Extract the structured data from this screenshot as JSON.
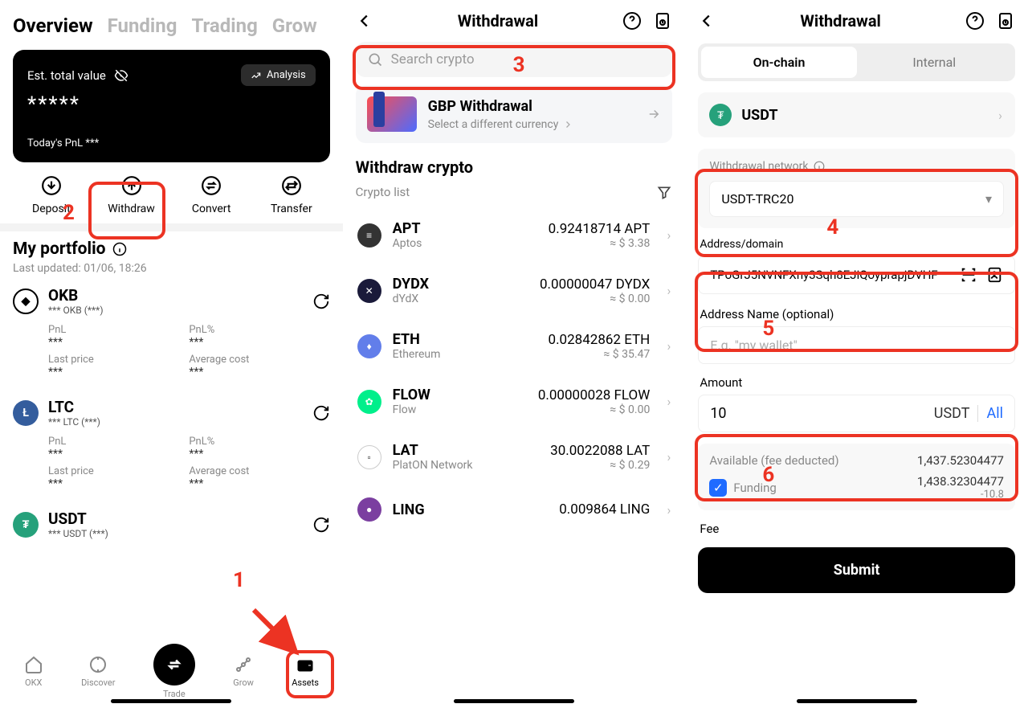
{
  "annotations": {
    "n1": "1",
    "n2": "2",
    "n3": "3",
    "n4": "4",
    "n5": "5",
    "n6": "6"
  },
  "screen1": {
    "tabs": {
      "overview": "Overview",
      "funding": "Funding",
      "trading": "Trading",
      "grow": "Grow"
    },
    "card": {
      "est_label": "Est. total value",
      "analysis": "Analysis",
      "masked": "*****",
      "today_pnl": "Today's PnL ***"
    },
    "actions": {
      "deposit": "Deposit",
      "withdraw": "Withdraw",
      "convert": "Convert",
      "transfer": "Transfer"
    },
    "portfolio": {
      "title": "My portfolio",
      "updated": "Last updated: 01/06, 18:26",
      "labels": {
        "pnl": "PnL",
        "pnl_pct": "PnL%",
        "last_price": "Last price",
        "avg_cost": "Average cost"
      },
      "coins": [
        {
          "symbol": "OKB",
          "subline": "*** OKB (***)",
          "pnl": "***",
          "pnl_pct": "***",
          "last_price": "***",
          "avg_cost": "***"
        },
        {
          "symbol": "LTC",
          "subline": "*** LTC (***)",
          "pnl": "***",
          "pnl_pct": "***",
          "last_price": "***",
          "avg_cost": "***"
        },
        {
          "symbol": "USDT",
          "subline": "*** USDT (***)"
        }
      ]
    },
    "bottom": {
      "okx": "OKX",
      "discover": "Discover",
      "trade": "Trade",
      "grow": "Grow",
      "assets": "Assets"
    }
  },
  "screen2": {
    "title": "Withdrawal",
    "search_placeholder": "Search crypto",
    "banner": {
      "title": "GBP Withdrawal",
      "subtitle": "Select a different currency"
    },
    "heading": "Withdraw crypto",
    "list_label": "Crypto list",
    "list": [
      {
        "symbol": "APT",
        "name": "Aptos",
        "amount": "0.92418714 APT",
        "approx": "≈ $ 3.38"
      },
      {
        "symbol": "DYDX",
        "name": "dYdX",
        "amount": "0.00000047 DYDX",
        "approx": "≈ $ 0.00"
      },
      {
        "symbol": "ETH",
        "name": "Ethereum",
        "amount": "0.02842862 ETH",
        "approx": "≈ $ 35.47"
      },
      {
        "symbol": "FLOW",
        "name": "Flow",
        "amount": "0.00000028 FLOW",
        "approx": "≈ $ 0.00"
      },
      {
        "symbol": "LAT",
        "name": "PlatON Network",
        "amount": "30.0022088 LAT",
        "approx": "≈ $ 0.29"
      },
      {
        "symbol": "LING",
        "name": "",
        "amount": "0.009864 LING",
        "approx": ""
      }
    ]
  },
  "screen3": {
    "title": "Withdrawal",
    "seg": {
      "onchain": "On-chain",
      "internal": "Internal"
    },
    "asset": "USDT",
    "network_label": "Withdrawal network",
    "network_value": "USDT-TRC20",
    "address_label": "Address/domain",
    "address_value": "TPoGrJ5NVNFXny3Sqh8EJiQoyprapjDVHF",
    "name_label": "Address Name (optional)",
    "name_placeholder": "E.g. \"my wallet\"",
    "amount_label": "Amount",
    "amount_value": "10",
    "amount_unit": "USDT",
    "amount_all": "All",
    "available_label": "Available (fee deducted)",
    "available_value": "1,437.52304477",
    "funding_label": "Funding",
    "funding_value": "1,438.32304477",
    "funding_delta": "-10.8",
    "fee_label": "Fee",
    "submit": "Submit"
  }
}
